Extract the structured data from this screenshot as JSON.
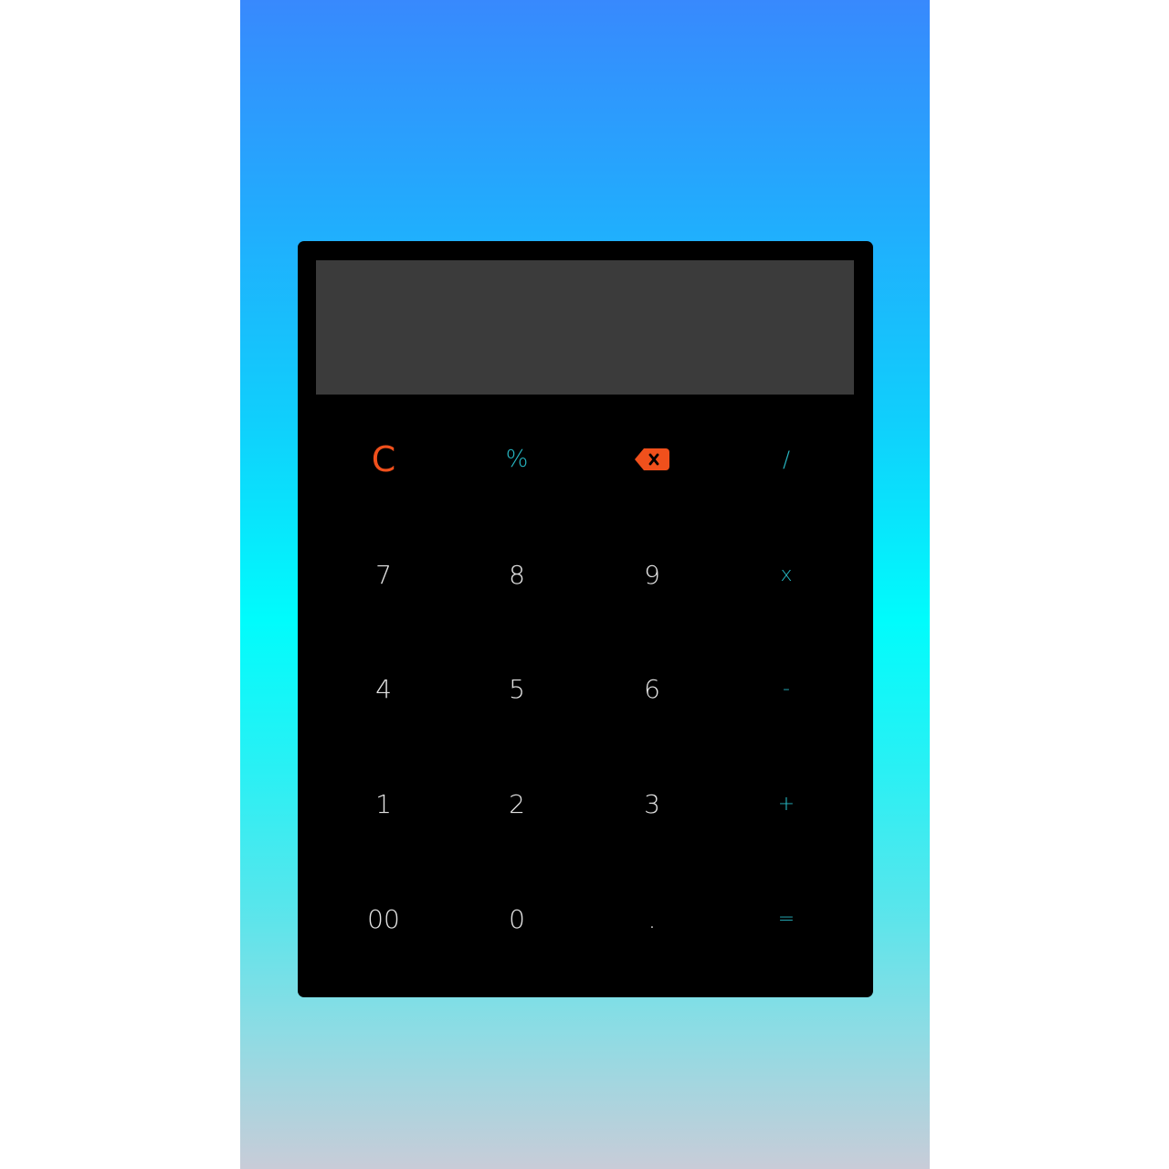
{
  "display": {
    "expression": "",
    "result": ""
  },
  "colors": {
    "background_top": "#3889fd",
    "background_middle": "#00fcfc",
    "background_bottom": "#c8ccd8",
    "calculator_body": "#000000",
    "display_panel": "#3b3b3b",
    "digit_text": "#e3e3e3",
    "operator_text": "#27b8c4",
    "accent_orange": "#f0501c"
  },
  "keys": {
    "clear": "C",
    "percent": "%",
    "backspace_icon": "backspace-icon",
    "divide": "/",
    "seven": "7",
    "eight": "8",
    "nine": "9",
    "multiply": "x",
    "four": "4",
    "five": "5",
    "six": "6",
    "subtract": "-",
    "one": "1",
    "two": "2",
    "three": "3",
    "add": "+",
    "double_zero": "00",
    "zero": "0",
    "decimal": ".",
    "equals": "="
  }
}
